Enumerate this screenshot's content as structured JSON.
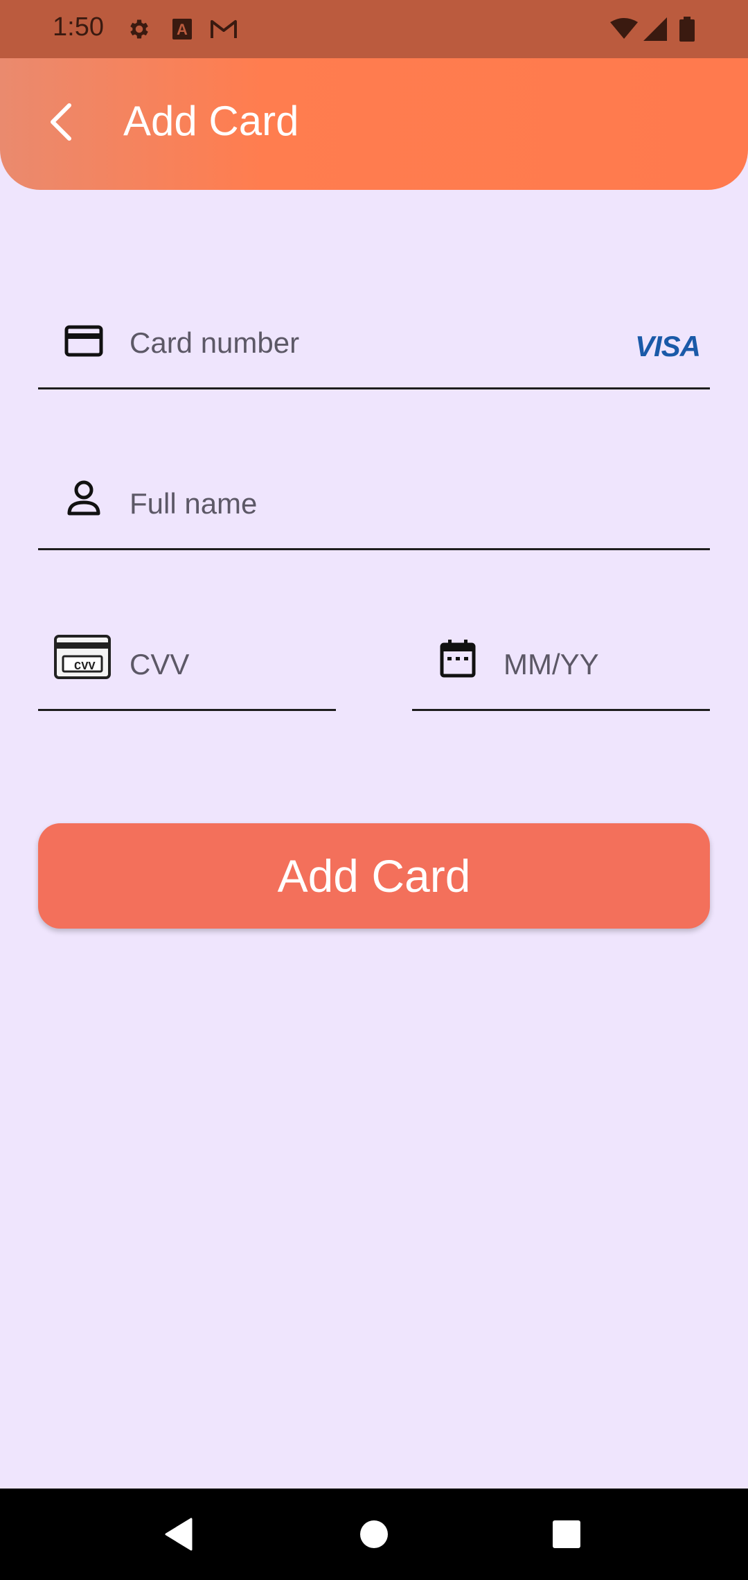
{
  "status_bar": {
    "time": "1:50",
    "icons": [
      "gear-icon",
      "a-notification-icon",
      "gmail-icon",
      "wifi-icon",
      "cell-signal-icon",
      "battery-icon"
    ]
  },
  "app_bar": {
    "title": "Add Card",
    "back_icon": "chevron-left-icon"
  },
  "form": {
    "card_number": {
      "placeholder": "Card number",
      "value": "",
      "icon": "credit-card-icon",
      "brand": "VISA"
    },
    "full_name": {
      "placeholder": "Full name",
      "value": "",
      "icon": "person-icon"
    },
    "cvv": {
      "placeholder": "CVV",
      "value": "",
      "icon": "cvv-card-icon",
      "icon_text": "CVV"
    },
    "expiry": {
      "placeholder": "MM/YY",
      "value": "",
      "icon": "calendar-icon"
    }
  },
  "submit": {
    "label": "Add Card"
  },
  "nav_bar": {
    "buttons": [
      "back-triangle-icon",
      "home-circle-icon",
      "recents-square-icon"
    ]
  },
  "colors": {
    "background": "#EFE5FD",
    "status_bar": "#BB5B3E",
    "app_bar_start": "#EA8A6E",
    "app_bar_end": "#FF7A4E",
    "button": "#F3705B",
    "visa_blue": "#1A5AA8",
    "visa_gold": "#F2A021"
  }
}
